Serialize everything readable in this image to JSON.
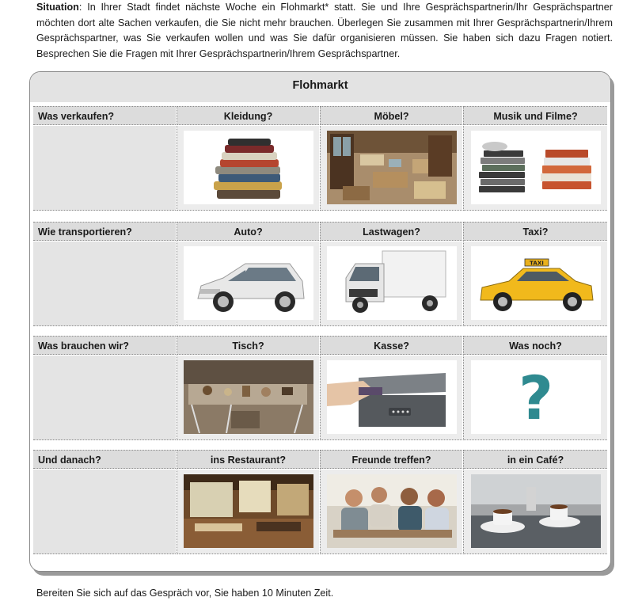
{
  "intro": {
    "lead": "Situation",
    "text": ": In Ihrer Stadt findet nächste Woche ein Flohmarkt* statt. Sie und Ihre Gesprächspartnerin/Ihr Gesprächspartner möchten dort alte Sachen verkaufen, die Sie nicht mehr brauchen. Überlegen Sie zusammen mit Ihrer Gesprächspartnerin/Ihrem Gesprächspartner, was Sie verkaufen wollen und was Sie dafür organisieren müssen. Sie haben sich dazu Fragen notiert. Besprechen Sie die Fragen mit Ihrer Gesprächspartnerin/Ihrem Gesprächspartner."
  },
  "card": {
    "title": "Flohmarkt",
    "sections": [
      {
        "question": "Was verkaufen?",
        "options": [
          {
            "label": "Kleidung?",
            "image": "folded-clothes-stack"
          },
          {
            "label": "Möbel?",
            "image": "furniture-store"
          },
          {
            "label": "Musik und Filme?",
            "image": "cd-dvd-stacks"
          }
        ]
      },
      {
        "question": "Wie transportieren?",
        "options": [
          {
            "label": "Auto?",
            "image": "white-car"
          },
          {
            "label": "Lastwagen?",
            "image": "white-truck"
          },
          {
            "label": "Taxi?",
            "image": "yellow-taxi"
          }
        ]
      },
      {
        "question": "Was brauchen wir?",
        "options": [
          {
            "label": "Tisch?",
            "image": "flea-market-table"
          },
          {
            "label": "Kasse?",
            "image": "cash-box"
          },
          {
            "label": "Was noch?",
            "image": "question-mark"
          }
        ]
      },
      {
        "question": "Und danach?",
        "options": [
          {
            "label": "ins Restaurant?",
            "image": "restaurant-interior"
          },
          {
            "label": "Freunde treffen?",
            "image": "friends-at-table"
          },
          {
            "label": "in ein Café?",
            "image": "coffee-cups"
          }
        ]
      }
    ]
  },
  "footer": "Bereiten Sie sich auf das Gespräch vor, Sie haben 10 Minuten Zeit."
}
